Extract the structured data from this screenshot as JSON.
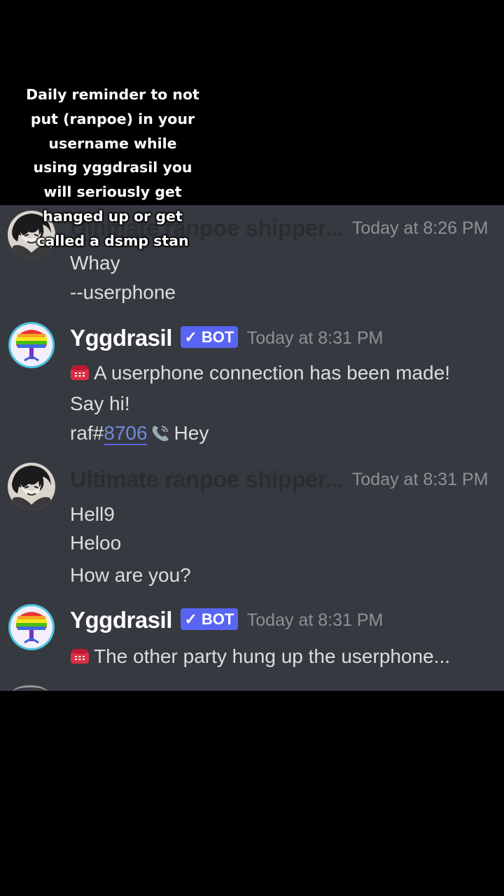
{
  "overlay": {
    "caption_lines": [
      "Daily reminder to not",
      "put (ranpoe) in your",
      "username while",
      "using yggdrasil you",
      "will seriously get",
      "hanged up or get",
      "called a dsmp stan"
    ]
  },
  "chat": {
    "messages": [
      {
        "author": "Ultimate ranpoe shipper...",
        "timestamp": "Today at 8:26 PM",
        "lines": [
          "Whay",
          "--userphone"
        ]
      },
      {
        "author": "Yggdrasil",
        "bot_tag": "✓ BOT",
        "timestamp": "Today at 8:31 PM",
        "lines": [
          "A userphone connection has been made!",
          "Say hi!"
        ],
        "relay": {
          "user_prefix": "raf#",
          "user_discriminator": "8706",
          "text": "Hey"
        }
      },
      {
        "author": "Ultimate ranpoe shipper...",
        "timestamp": "Today at 8:31 PM",
        "lines": [
          "Hell9",
          "Heloo",
          "How are you?"
        ]
      },
      {
        "author": "Yggdrasil",
        "bot_tag": "✓ BOT",
        "timestamp": "Today at 8:31 PM",
        "lines": [
          "The other party hung up the userphone..."
        ]
      }
    ]
  },
  "icons": {
    "telephone_emoji": "telephone-icon",
    "relay_phone_emoji": "phone-receiver-icon",
    "user_avatar": "anime-character-avatar",
    "bot_avatar": "rainbow-tree-avatar"
  },
  "colors": {
    "chat_background": "#36393f",
    "bot_tag": "#5865f2",
    "mention": "#7289da",
    "timestamp": "#8e9297",
    "message_text": "#dcddde"
  }
}
